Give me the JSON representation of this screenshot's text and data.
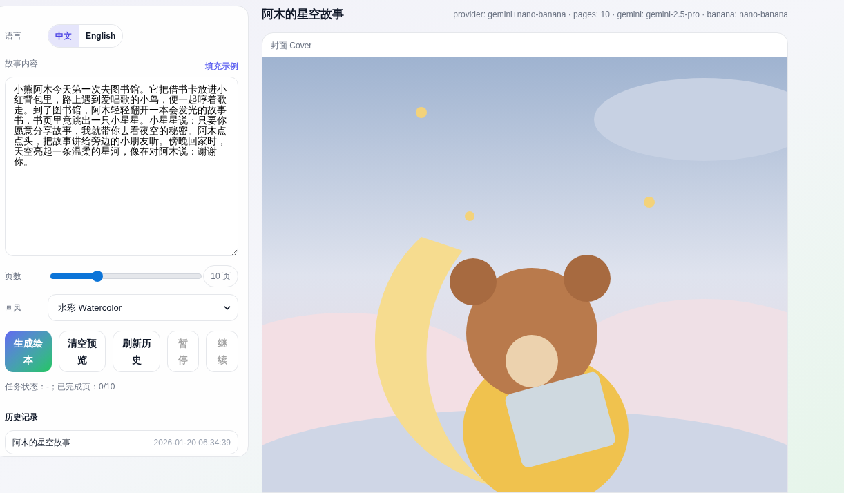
{
  "sidebar": {
    "language": {
      "label": "语言",
      "options": [
        {
          "label": "中文",
          "selected": true
        },
        {
          "label": "English",
          "selected": false
        }
      ]
    },
    "story": {
      "label": "故事内容",
      "fill_link": "填充示例",
      "value": "小熊阿木今天第一次去图书馆。它把借书卡放进小红背包里，路上遇到爱唱歌的小鸟，便一起哼着歌走。到了图书馆，阿木轻轻翻开一本会发光的故事书，书页里竟跳出一只小星星。小星星说：只要你愿意分享故事，我就带你去看夜空的秘密。阿木点点头，把故事讲给旁边的小朋友听。傍晚回家时，天空亮起一条温柔的星河，像在对阿木说：谢谢你。"
    },
    "pages": {
      "label": "页数",
      "level": 0.31,
      "reading": "10 页"
    },
    "style": {
      "label": "画风",
      "value": "水彩 Watercolor"
    },
    "buttons": [
      {
        "label": "生成绘本",
        "kind": "primary",
        "disabled": false
      },
      {
        "label": "清空预览",
        "kind": "secondary",
        "disabled": false
      },
      {
        "label": "刷新历史",
        "kind": "secondary",
        "disabled": false
      },
      {
        "label": "暂停",
        "kind": "secondary",
        "disabled": true
      },
      {
        "label": "继续",
        "kind": "secondary",
        "disabled": true
      }
    ],
    "status": "任务状态：-；已完成页：0/10",
    "history": {
      "title": "历史记录",
      "items": [
        {
          "title": "阿木的星空故事",
          "time": "2026-01-20 06:34:39"
        }
      ]
    }
  },
  "main": {
    "title": "阿木的星空故事",
    "meta": "provider: gemini+nano-banana · pages: 10 · gemini: gemini-2.5-pro · banana: nano-banana",
    "cover": {
      "label": "封面 Cover",
      "kind": "picture"
    }
  }
}
